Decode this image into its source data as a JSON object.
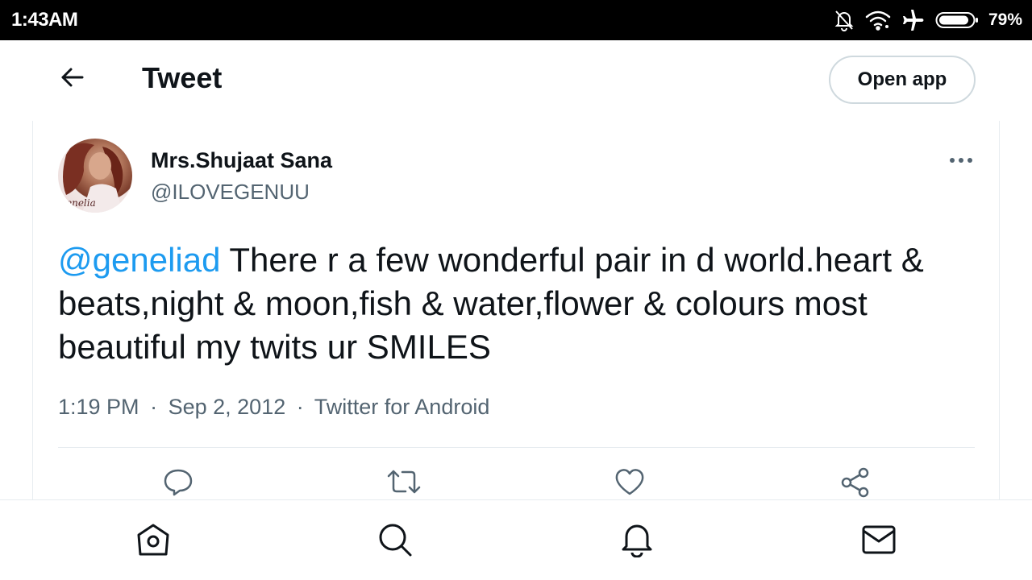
{
  "status_bar": {
    "time": "1:43AM",
    "battery_percent": "79%",
    "icons": [
      "notifications-off-icon",
      "wifi-icon",
      "airplane-mode-icon",
      "battery-icon"
    ]
  },
  "header": {
    "back_icon": "arrow-left-icon",
    "title": "Tweet",
    "open_app_label": "Open app"
  },
  "tweet": {
    "author": {
      "display_name": "Mrs.Shujaat Sana",
      "handle": "@ILOVEGENUU",
      "avatar_caption": "enelia"
    },
    "mention": "@geneliad",
    "text": " There r a few wonderful pair in d world.heart & beats,night & moon,fish & water,flower & colours most beautiful my twits ur SMILES",
    "time": "1:19 PM",
    "separator": "·",
    "date": "Sep 2, 2012",
    "source": "Twitter for Android"
  },
  "actions": [
    "reply-icon",
    "retweet-icon",
    "like-icon",
    "share-icon"
  ],
  "bottom_nav": [
    "home-icon",
    "search-icon",
    "notifications-icon",
    "messages-icon"
  ],
  "colors": {
    "link": "#1d9bf0",
    "secondary_text": "#536471",
    "primary_text": "#0f1419",
    "border": "#cfd9de",
    "status_bar_bg": "#000000"
  }
}
